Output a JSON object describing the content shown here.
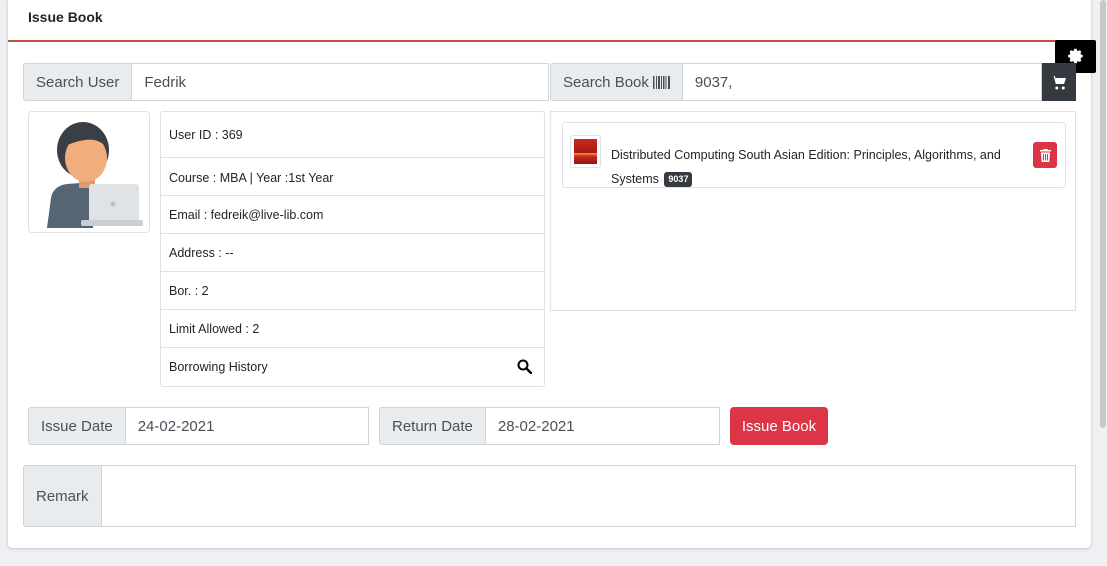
{
  "card": {
    "title": "Issue Book"
  },
  "search_user": {
    "label": "Search User",
    "value": "Fedrik"
  },
  "search_book": {
    "label": "Search Book",
    "value": "9037,"
  },
  "icons": {
    "gear": "gear-icon",
    "barcode": "barcode-icon",
    "cart": "cart-icon",
    "search": "search-icon",
    "trash": "trash-icon"
  },
  "user_info": {
    "user_id": "User ID : 369",
    "course": "Course : MBA | Year :1st Year",
    "email": "Email : fedreik@live-lib.com",
    "address": "Address : --",
    "borrowed": "Bor. : 2",
    "limit": "Limit Allowed : 2",
    "history": "Borrowing History"
  },
  "books": [
    {
      "title": "Distributed Computing South Asian Edition: Principles, Algorithms, and Systems",
      "code": "9037"
    }
  ],
  "issue_date": {
    "label": "Issue Date",
    "value": "24-02-2021"
  },
  "return_date": {
    "label": "Return Date",
    "value": "28-02-2021"
  },
  "issue_button": {
    "label": "Issue Book"
  },
  "remark": {
    "label": "Remark",
    "value": ""
  },
  "colors": {
    "accent_rule": "#c0503b",
    "danger": "#dc3545",
    "dark": "#343a40",
    "addon_bg": "#e9ecef"
  }
}
